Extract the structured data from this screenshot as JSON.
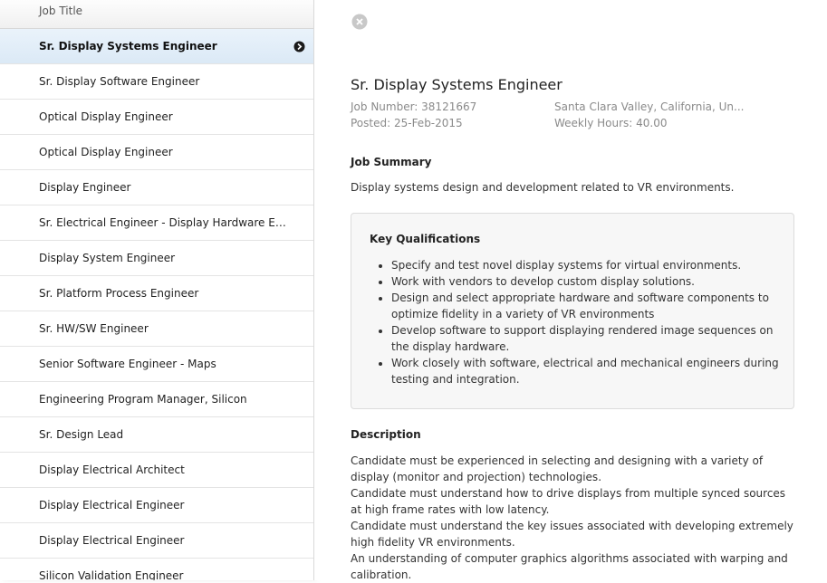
{
  "sidebar": {
    "header": "Job Title",
    "jobs": [
      "Sr. Display Systems Engineer",
      "Sr. Display Software Engineer",
      "Optical Display Engineer",
      "Optical Display Engineer",
      "Display Engineer",
      "Sr. Electrical Engineer - Display Hardware Engineer",
      "Display System Engineer",
      "Sr. Platform Process Engineer",
      "Sr. HW/SW Engineer",
      "Senior Software Engineer - Maps",
      "Engineering Program Manager, Silicon",
      "Sr. Design Lead",
      "Display Electrical Architect",
      "Display Electrical Engineer",
      "Display Electrical Engineer",
      "Silicon Validation Engineer"
    ]
  },
  "detail": {
    "title": "Sr. Display Systems Engineer",
    "job_number": "Job Number: 38121667",
    "posted": "Posted: 25-Feb-2015",
    "location": "Santa Clara Valley, California, Un...",
    "weekly_hours": "Weekly Hours: 40.00",
    "summary_heading": "Job Summary",
    "summary": "Display systems design and development related to VR environments.",
    "qualifications_heading": "Key Qualifications",
    "qualifications": [
      "Specify and test novel display systems for virtual environments.",
      "Work with vendors to develop custom display solutions.",
      "Design and select appropriate hardware and software components to optimize fidelity in a variety of VR environments",
      "Develop software to support displaying rendered image sequences on the display hardware.",
      "Work closely with software, electrical and mechanical engineers during testing and integration."
    ],
    "description_heading": "Description",
    "description": [
      "Candidate must be experienced in selecting and designing with a variety of display (monitor and projection) technologies.",
      "Candidate must understand how to drive displays from multiple synced sources at high frame rates with low latency.",
      "Candidate must understand the key issues associated with developing extremely high fidelity VR environments.",
      "An understanding of computer graphics algorithms associated with warping and calibration."
    ]
  }
}
